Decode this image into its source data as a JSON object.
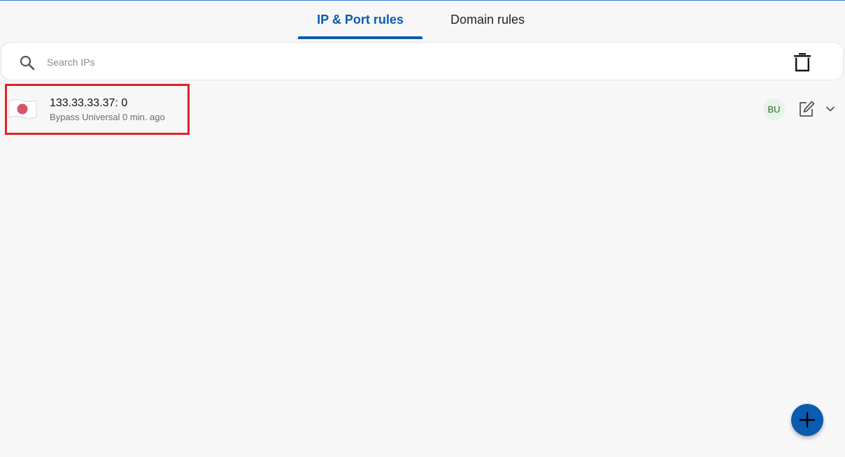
{
  "tabs": [
    {
      "label": "IP & Port rules",
      "active": true
    },
    {
      "label": "Domain rules",
      "active": false
    }
  ],
  "search": {
    "placeholder": "Search IPs",
    "value": "",
    "icon": "search-icon"
  },
  "toolbar": {
    "delete_icon": "trash-icon"
  },
  "rules": [
    {
      "flag": "japan-flag-icon",
      "title": "133.33.33.37: 0",
      "subtitle": "Bypass Universal 0 min. ago",
      "badge": "BU",
      "edit_icon": "edit-icon",
      "expand_icon": "chevron-down-icon"
    }
  ],
  "fab": {
    "icon": "plus-icon"
  },
  "colors": {
    "accent": "#0a5cb0",
    "highlight": "#e0222a",
    "badge_bg": "#e7f3e7",
    "badge_text": "#2a6b2a",
    "background": "#f7f7f7"
  }
}
